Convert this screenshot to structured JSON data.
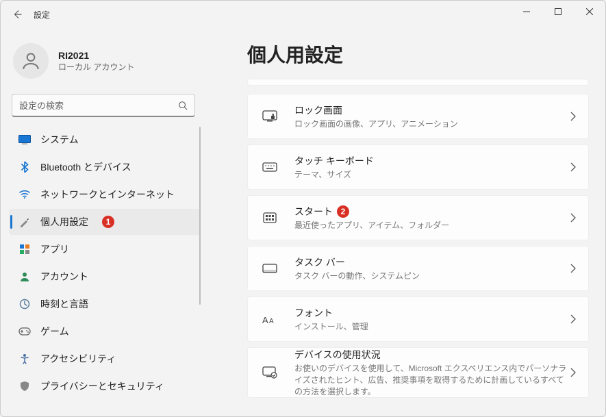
{
  "titlebar": {
    "title": "設定"
  },
  "user": {
    "name": "RI2021",
    "subtitle": "ローカル アカウント"
  },
  "search": {
    "placeholder": "設定の検索"
  },
  "sidebar": {
    "items": [
      {
        "id": "system",
        "label": "システム"
      },
      {
        "id": "bluetooth",
        "label": "Bluetooth とデバイス"
      },
      {
        "id": "network",
        "label": "ネットワークとインターネット"
      },
      {
        "id": "personalization",
        "label": "個人用設定",
        "selected": true,
        "annotation": "1"
      },
      {
        "id": "apps",
        "label": "アプリ"
      },
      {
        "id": "accounts",
        "label": "アカウント"
      },
      {
        "id": "time",
        "label": "時刻と言語"
      },
      {
        "id": "gaming",
        "label": "ゲーム"
      },
      {
        "id": "accessibility",
        "label": "アクセシビリティ"
      },
      {
        "id": "privacy",
        "label": "プライバシーとセキュリティ"
      }
    ]
  },
  "page": {
    "title": "個人用設定",
    "cards": [
      {
        "id": "lock",
        "title": "ロック画面",
        "subtitle": "ロック画面の画像、アプリ、アニメーション"
      },
      {
        "id": "touchkb",
        "title": "タッチ キーボード",
        "subtitle": "テーマ、サイズ"
      },
      {
        "id": "start",
        "title": "スタート",
        "subtitle": "最近使ったアプリ、アイテム、フォルダー",
        "annotation": "2"
      },
      {
        "id": "taskbar",
        "title": "タスク バー",
        "subtitle": "タスク バーの動作、システムピン"
      },
      {
        "id": "fonts",
        "title": "フォント",
        "subtitle": "インストール、管理"
      },
      {
        "id": "usage",
        "title": "デバイスの使用状況",
        "subtitle": "お使いのデバイスを使用して、Microsoft エクスペリエンス内でパーソナライズされたヒント、広告、推奨事項を取得するために計画しているすべての方法を選択します。"
      }
    ]
  }
}
